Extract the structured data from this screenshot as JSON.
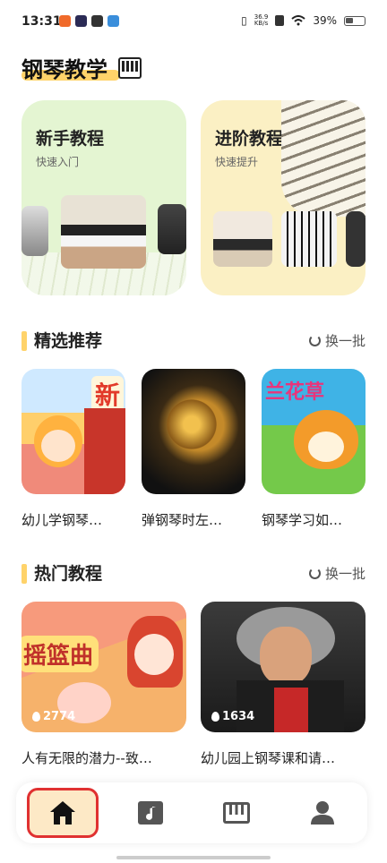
{
  "status_bar": {
    "time": "13:31",
    "net_speed_value": "36.9",
    "net_speed_unit": "KB/s",
    "battery": "39%"
  },
  "header": {
    "title": "钢琴教学",
    "icon": "piano-icon"
  },
  "course_cards": [
    {
      "title": "新手教程",
      "subtitle": "快速入门",
      "bg": "#e4f5d2"
    },
    {
      "title": "进阶教程",
      "subtitle": "快速提升",
      "bg": "#fbf0c4"
    }
  ],
  "featured": {
    "title": "精选推荐",
    "refresh_label": "换一批",
    "items": [
      {
        "label": "幼儿学钢琴…"
      },
      {
        "label": "弹钢琴时左…"
      },
      {
        "label": "钢琴学习如…"
      }
    ]
  },
  "hot": {
    "title": "热门教程",
    "refresh_label": "换一批",
    "items": [
      {
        "label": "人有无限的潜力--致…",
        "views": "2774",
        "thumb_text": "摇篮曲"
      },
      {
        "label": "幼儿园上钢琴课和请…",
        "views": "1634"
      }
    ]
  },
  "featured_thumb_texts": [
    "新",
    "兰花草"
  ],
  "bottom_nav": [
    {
      "name": "home",
      "icon": "home-icon",
      "active": true
    },
    {
      "name": "music",
      "icon": "music-folder-icon",
      "active": false
    },
    {
      "name": "piano",
      "icon": "piano-keys-icon",
      "active": false
    },
    {
      "name": "profile",
      "icon": "person-icon",
      "active": false
    }
  ],
  "colors": {
    "accent": "#ffd36a",
    "active_tab_bg": "#fde9c6",
    "active_tab_border": "#e03131"
  }
}
